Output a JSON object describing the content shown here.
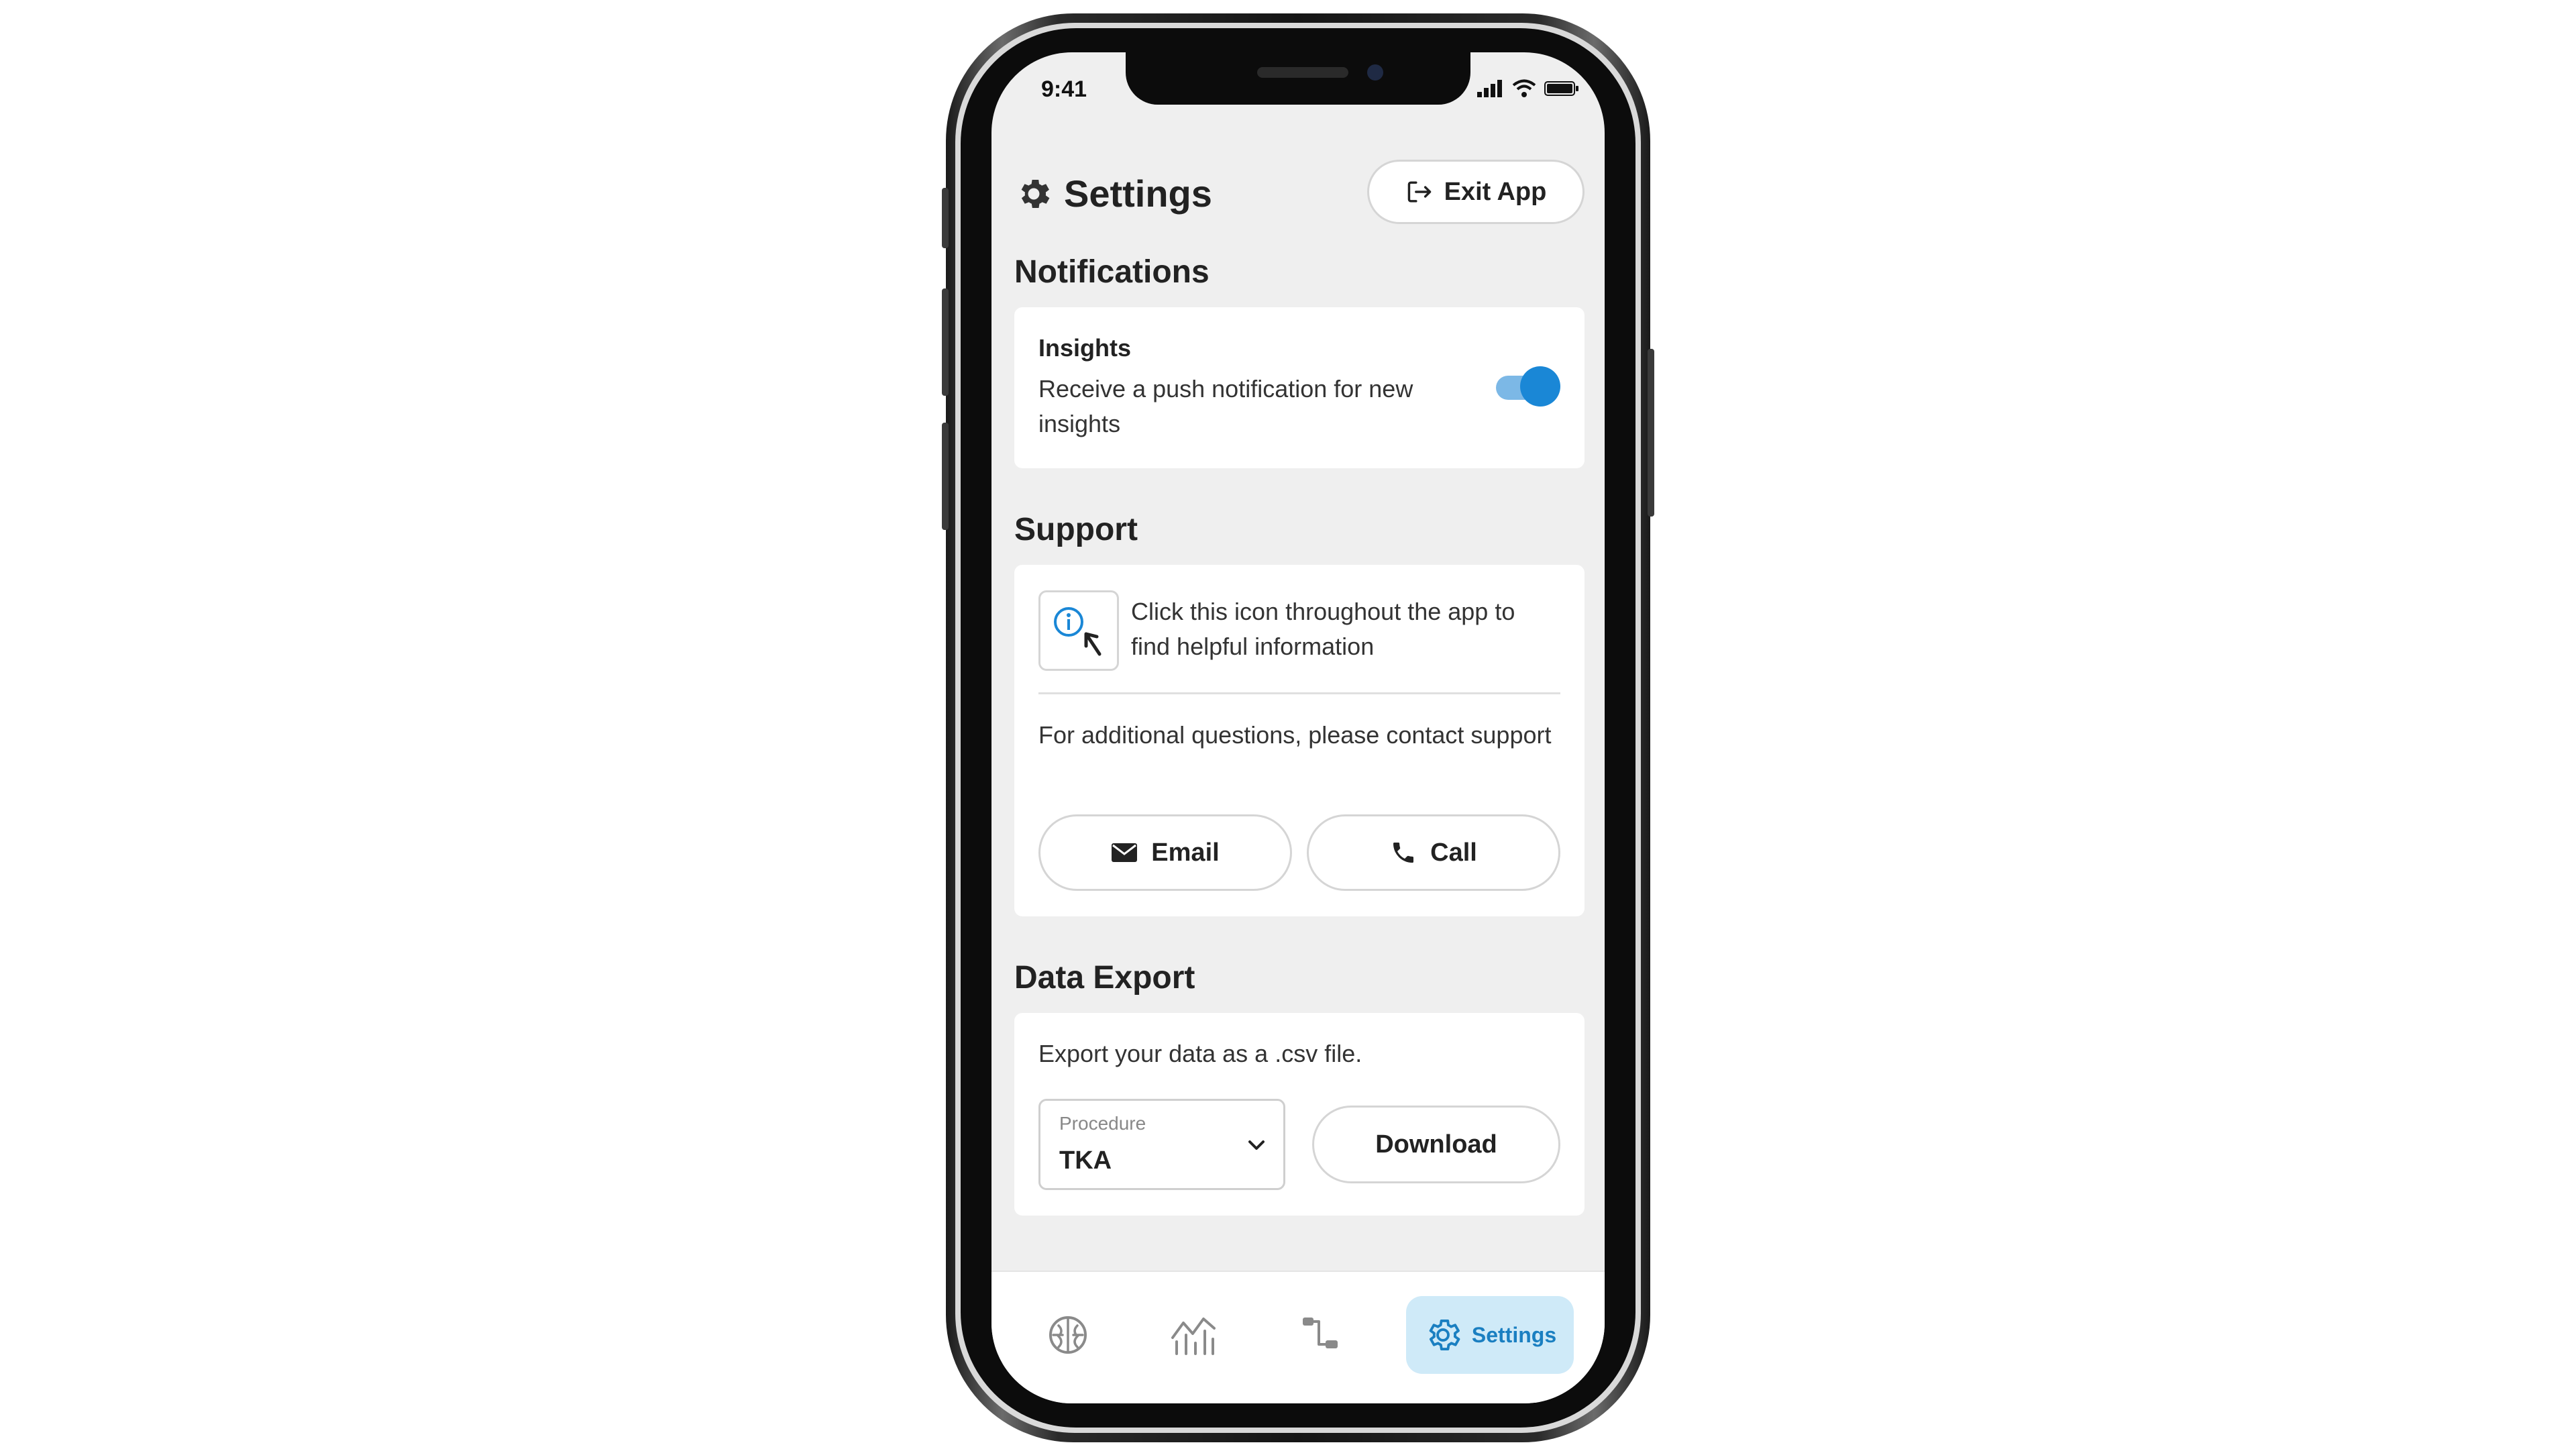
{
  "status_bar": {
    "time": "9:41"
  },
  "header": {
    "title": "Settings",
    "exit_label": "Exit App"
  },
  "notifications": {
    "section_title": "Notifications",
    "item_title": "Insights",
    "item_description": "Receive a push notification for new insights",
    "enabled": true
  },
  "support": {
    "section_title": "Support",
    "help_text": "Click this icon throughout the app to find helpful information",
    "contact_text": "For additional questions, please contact support",
    "email_label": "Email",
    "call_label": "Call"
  },
  "data_export": {
    "section_title": "Data Export",
    "description": "Export your data as a .csv file.",
    "procedure_label": "Procedure",
    "procedure_value": "TKA",
    "download_label": "Download"
  },
  "bottom_nav": {
    "active_label": "Settings",
    "items": [
      {
        "icon": "brain-icon"
      },
      {
        "icon": "chart-icon"
      },
      {
        "icon": "pathway-icon"
      },
      {
        "icon": "gear-icon"
      }
    ]
  },
  "colors": {
    "accent": "#1a87d6",
    "accent_light": "#cfeaf8",
    "screen_bg": "#efefef",
    "card_bg": "#ffffff"
  }
}
